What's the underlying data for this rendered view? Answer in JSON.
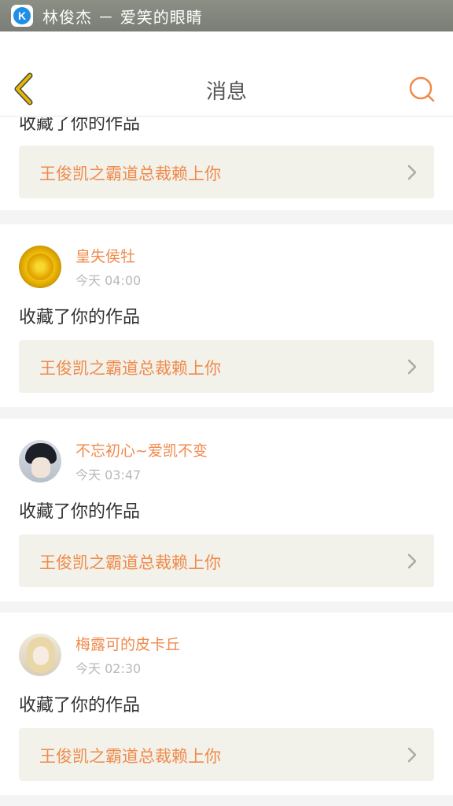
{
  "status_bar": {
    "app_icon": "kugou-k-icon",
    "app_icon_letter": "K",
    "now_playing": "林俊杰 － 爱笑的眼睛"
  },
  "header": {
    "back_icon": "chevron-left-icon",
    "title": "消息",
    "search_icon": "search-icon"
  },
  "colors": {
    "accent": "#f08a4b",
    "back_arrow": "#e6b800",
    "link_background": "#f2f2ea"
  },
  "messages": [
    {
      "action": "收藏了你的作品",
      "work_title": "王俊凯之霸道总裁赖上你"
    },
    {
      "avatar": "sunflower-avatar",
      "username": "皇失侯牡",
      "time": "今天 04:00",
      "action": "收藏了你的作品",
      "work_title": "王俊凯之霸道总裁赖上你"
    },
    {
      "avatar": "boy-avatar",
      "username": "不忘初心~爱凯不变",
      "time": "今天 03:47",
      "action": "收藏了你的作品",
      "work_title": "王俊凯之霸道总裁赖上你"
    },
    {
      "avatar": "girl-avatar",
      "username": "梅露可的皮卡丘",
      "time": "今天 02:30",
      "action": "收藏了你的作品",
      "work_title": "王俊凯之霸道总裁赖上你"
    }
  ]
}
